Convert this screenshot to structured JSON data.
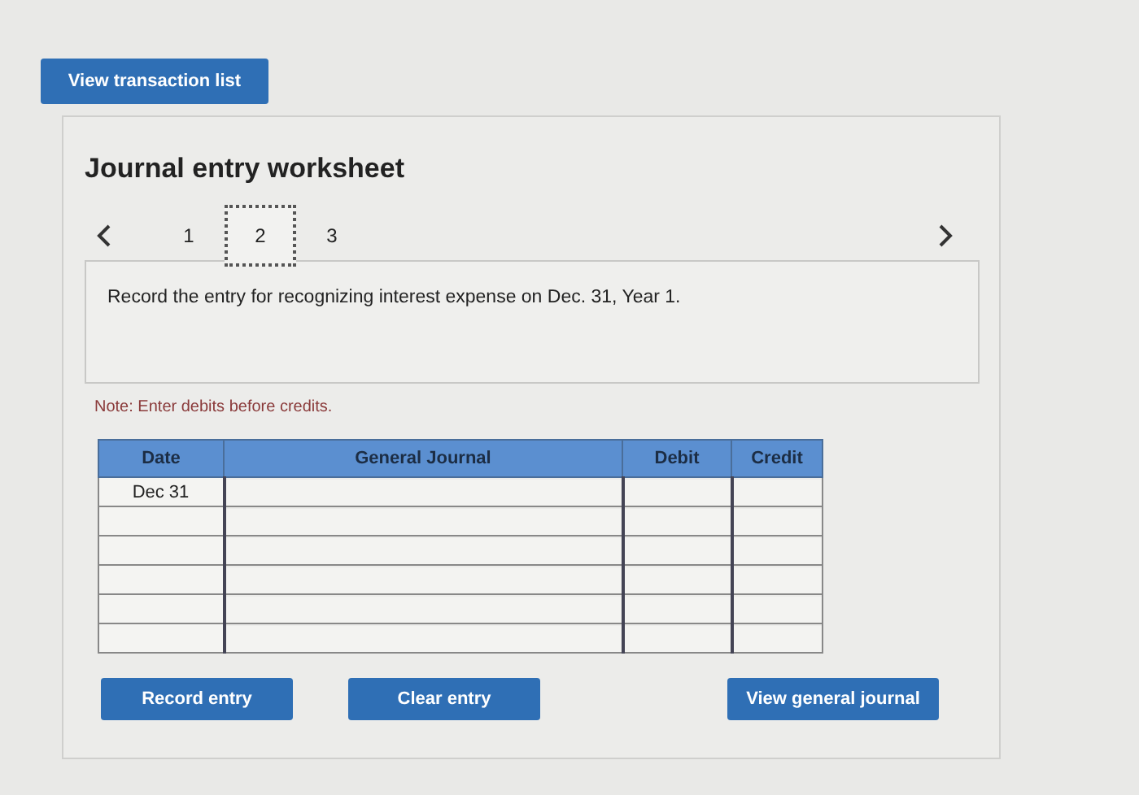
{
  "top_button": "View transaction list",
  "worksheet": {
    "title": "Journal entry worksheet",
    "pages": [
      {
        "label": "1",
        "selected": false
      },
      {
        "label": "2",
        "selected": true
      },
      {
        "label": "3",
        "selected": false
      }
    ],
    "instruction": "Record the entry for recognizing interest expense on Dec. 31, Year 1.",
    "note": "Note: Enter debits before credits.",
    "table": {
      "columns": [
        "Date",
        "General Journal",
        "Debit",
        "Credit"
      ],
      "rows": [
        {
          "date": "Dec 31"
        },
        {},
        {},
        {},
        {},
        {}
      ]
    },
    "buttons": [
      "Record entry",
      "Clear entry",
      "View general journal"
    ]
  }
}
